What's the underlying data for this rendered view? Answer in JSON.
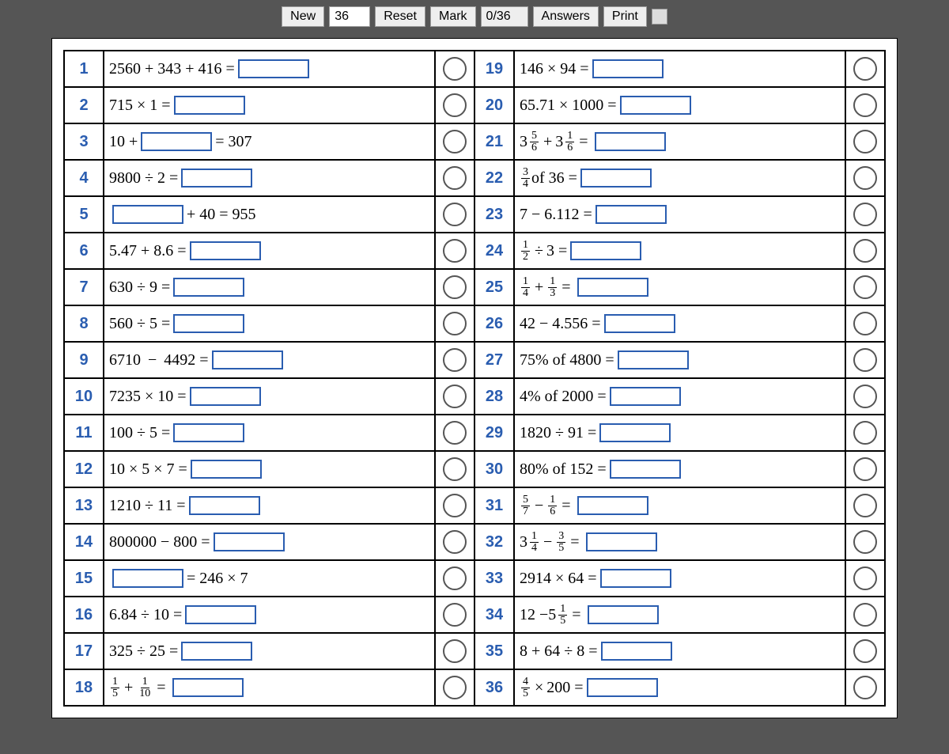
{
  "toolbar": {
    "new_label": "New",
    "count": "36",
    "reset_label": "Reset",
    "mark_label": "Mark",
    "score": "0/36",
    "answers_label": "Answers",
    "print_label": "Print"
  },
  "questions": [
    {
      "n": "1",
      "parts": [
        {
          "t": "text",
          "v": "2560 + 343 + 416 ="
        },
        {
          "t": "ans"
        }
      ]
    },
    {
      "n": "2",
      "parts": [
        {
          "t": "text",
          "v": "715 × 1 ="
        },
        {
          "t": "ans"
        }
      ]
    },
    {
      "n": "3",
      "parts": [
        {
          "t": "text",
          "v": "10 +"
        },
        {
          "t": "ans"
        },
        {
          "t": "text",
          "v": "= 307"
        }
      ]
    },
    {
      "n": "4",
      "parts": [
        {
          "t": "text",
          "v": "9800 ÷ 2 ="
        },
        {
          "t": "ans"
        }
      ]
    },
    {
      "n": "5",
      "parts": [
        {
          "t": "ans"
        },
        {
          "t": "text",
          "v": "+ 40 = 955"
        }
      ]
    },
    {
      "n": "6",
      "parts": [
        {
          "t": "text",
          "v": "5.47 + 8.6 ="
        },
        {
          "t": "ans"
        }
      ]
    },
    {
      "n": "7",
      "parts": [
        {
          "t": "text",
          "v": "630 ÷ 9 ="
        },
        {
          "t": "ans"
        }
      ]
    },
    {
      "n": "8",
      "parts": [
        {
          "t": "text",
          "v": "560 ÷ 5 ="
        },
        {
          "t": "ans"
        }
      ]
    },
    {
      "n": "9",
      "parts": [
        {
          "t": "text",
          "v": "6710  −  4492 ="
        },
        {
          "t": "ans"
        }
      ]
    },
    {
      "n": "10",
      "parts": [
        {
          "t": "text",
          "v": "7235 × 10 ="
        },
        {
          "t": "ans"
        }
      ]
    },
    {
      "n": "11",
      "parts": [
        {
          "t": "text",
          "v": "100 ÷ 5 ="
        },
        {
          "t": "ans"
        }
      ]
    },
    {
      "n": "12",
      "parts": [
        {
          "t": "text",
          "v": "10 × 5 × 7 ="
        },
        {
          "t": "ans"
        }
      ]
    },
    {
      "n": "13",
      "parts": [
        {
          "t": "text",
          "v": "1210 ÷ 11 ="
        },
        {
          "t": "ans"
        }
      ]
    },
    {
      "n": "14",
      "parts": [
        {
          "t": "text",
          "v": "800000 − 800 ="
        },
        {
          "t": "ans"
        }
      ]
    },
    {
      "n": "15",
      "parts": [
        {
          "t": "ans"
        },
        {
          "t": "text",
          "v": "= 246 × 7"
        }
      ]
    },
    {
      "n": "16",
      "parts": [
        {
          "t": "text",
          "v": "6.84 ÷ 10 ="
        },
        {
          "t": "ans"
        }
      ]
    },
    {
      "n": "17",
      "parts": [
        {
          "t": "text",
          "v": "325 ÷ 25 ="
        },
        {
          "t": "ans"
        }
      ]
    },
    {
      "n": "18",
      "parts": [
        {
          "t": "frac",
          "num": "1",
          "den": "5"
        },
        {
          "t": "op",
          "v": "+"
        },
        {
          "t": "frac",
          "num": "1",
          "den": "10"
        },
        {
          "t": "op",
          "v": "="
        },
        {
          "t": "ans"
        }
      ]
    },
    {
      "n": "19",
      "parts": [
        {
          "t": "text",
          "v": "146 × 94 ="
        },
        {
          "t": "ans"
        }
      ]
    },
    {
      "n": "20",
      "parts": [
        {
          "t": "text",
          "v": "65.71 × 1000 ="
        },
        {
          "t": "ans"
        }
      ]
    },
    {
      "n": "21",
      "parts": [
        {
          "t": "mixed",
          "w": "3",
          "num": "5",
          "den": "6"
        },
        {
          "t": "op",
          "v": "+"
        },
        {
          "t": "mixed",
          "w": "3",
          "num": "1",
          "den": "6"
        },
        {
          "t": "op",
          "v": "="
        },
        {
          "t": "ans"
        }
      ]
    },
    {
      "n": "22",
      "parts": [
        {
          "t": "frac",
          "num": "3",
          "den": "4"
        },
        {
          "t": "text",
          "v": " of 36 ="
        },
        {
          "t": "ans"
        }
      ]
    },
    {
      "n": "23",
      "parts": [
        {
          "t": "text",
          "v": "7 − 6.112 ="
        },
        {
          "t": "ans"
        }
      ]
    },
    {
      "n": "24",
      "parts": [
        {
          "t": "frac",
          "num": "1",
          "den": "2"
        },
        {
          "t": "op",
          "v": "÷"
        },
        {
          "t": "text",
          "v": "3 ="
        },
        {
          "t": "ans"
        }
      ]
    },
    {
      "n": "25",
      "parts": [
        {
          "t": "frac",
          "num": "1",
          "den": "4"
        },
        {
          "t": "op",
          "v": "+"
        },
        {
          "t": "frac",
          "num": "1",
          "den": "3"
        },
        {
          "t": "op",
          "v": "="
        },
        {
          "t": "ans"
        }
      ]
    },
    {
      "n": "26",
      "parts": [
        {
          "t": "text",
          "v": "42 − 4.556 ="
        },
        {
          "t": "ans"
        }
      ]
    },
    {
      "n": "27",
      "parts": [
        {
          "t": "text",
          "v": "75% of 4800 ="
        },
        {
          "t": "ans"
        }
      ]
    },
    {
      "n": "28",
      "parts": [
        {
          "t": "text",
          "v": "4% of 2000 ="
        },
        {
          "t": "ans"
        }
      ]
    },
    {
      "n": "29",
      "parts": [
        {
          "t": "text",
          "v": "1820 ÷ 91 ="
        },
        {
          "t": "ans"
        }
      ]
    },
    {
      "n": "30",
      "parts": [
        {
          "t": "text",
          "v": "80% of 152 ="
        },
        {
          "t": "ans"
        }
      ]
    },
    {
      "n": "31",
      "parts": [
        {
          "t": "frac",
          "num": "5",
          "den": "7"
        },
        {
          "t": "op",
          "v": "−"
        },
        {
          "t": "frac",
          "num": "1",
          "den": "6"
        },
        {
          "t": "op",
          "v": "="
        },
        {
          "t": "ans"
        }
      ]
    },
    {
      "n": "32",
      "parts": [
        {
          "t": "mixed",
          "w": "3",
          "num": "1",
          "den": "4"
        },
        {
          "t": "op",
          "v": "−"
        },
        {
          "t": "frac",
          "num": "3",
          "den": "5"
        },
        {
          "t": "op",
          "v": "="
        },
        {
          "t": "ans"
        }
      ]
    },
    {
      "n": "33",
      "parts": [
        {
          "t": "text",
          "v": "2914 × 64 ="
        },
        {
          "t": "ans"
        }
      ]
    },
    {
      "n": "34",
      "parts": [
        {
          "t": "text",
          "v": "12 −"
        },
        {
          "t": "mixed",
          "w": "5",
          "num": "1",
          "den": "5"
        },
        {
          "t": "op",
          "v": "="
        },
        {
          "t": "ans"
        }
      ]
    },
    {
      "n": "35",
      "parts": [
        {
          "t": "text",
          "v": "8 + 64 ÷ 8 ="
        },
        {
          "t": "ans"
        }
      ]
    },
    {
      "n": "36",
      "parts": [
        {
          "t": "frac",
          "num": "4",
          "den": "5"
        },
        {
          "t": "op",
          "v": "×"
        },
        {
          "t": "text",
          "v": "200 ="
        },
        {
          "t": "ans"
        }
      ]
    }
  ]
}
